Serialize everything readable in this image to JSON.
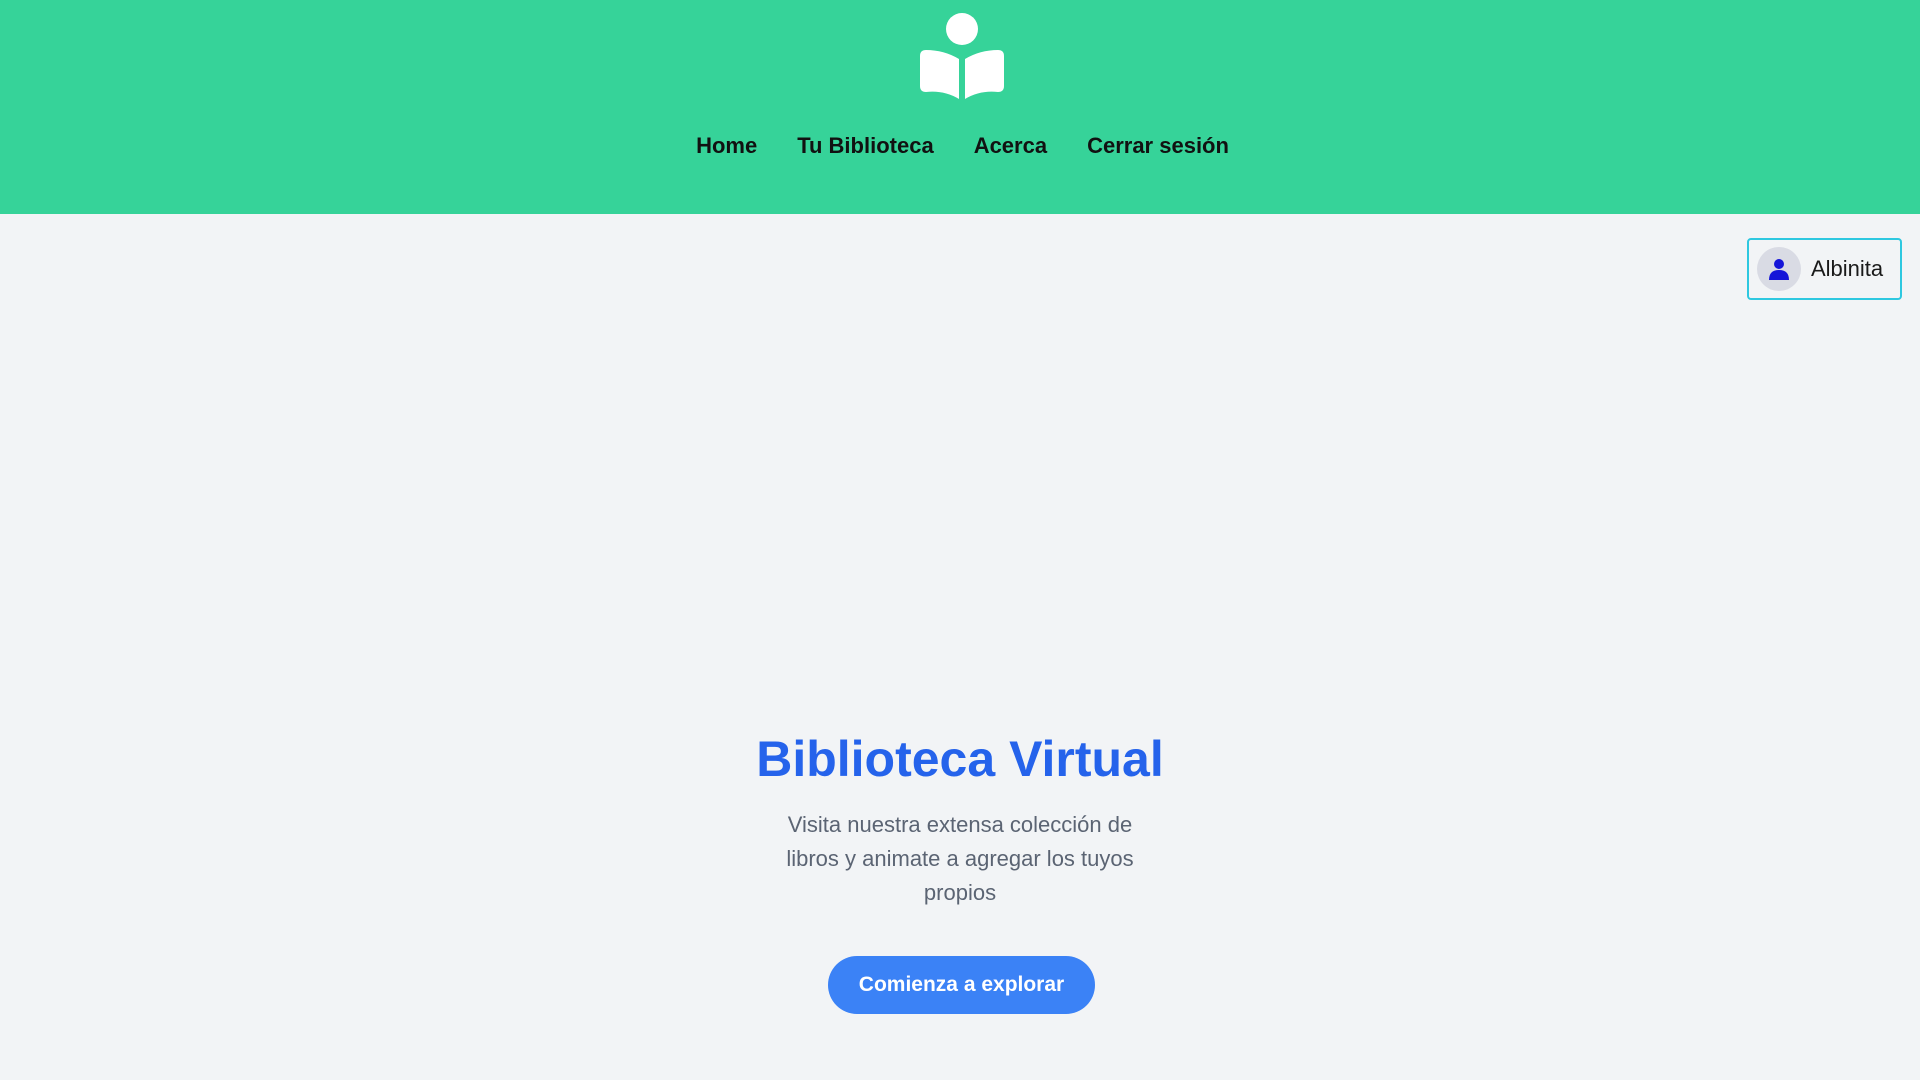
{
  "header": {
    "logo_icon": "reading-person-book-icon",
    "background_color": "#36d399",
    "nav": [
      {
        "label": "Home"
      },
      {
        "label": "Tu Biblioteca"
      },
      {
        "label": "Acerca"
      },
      {
        "label": "Cerrar sesión"
      }
    ]
  },
  "user": {
    "name": "Albinita",
    "avatar_icon": "user-icon",
    "border_color": "#2ec8e0"
  },
  "hero": {
    "title": "Biblioteca Virtual",
    "title_color": "#2563eb",
    "description": "Visita nuestra extensa colección de libros y animate a agregar los tuyos propios",
    "cta_label": "Comienza a explorar",
    "cta_color": "#3b82f6"
  }
}
